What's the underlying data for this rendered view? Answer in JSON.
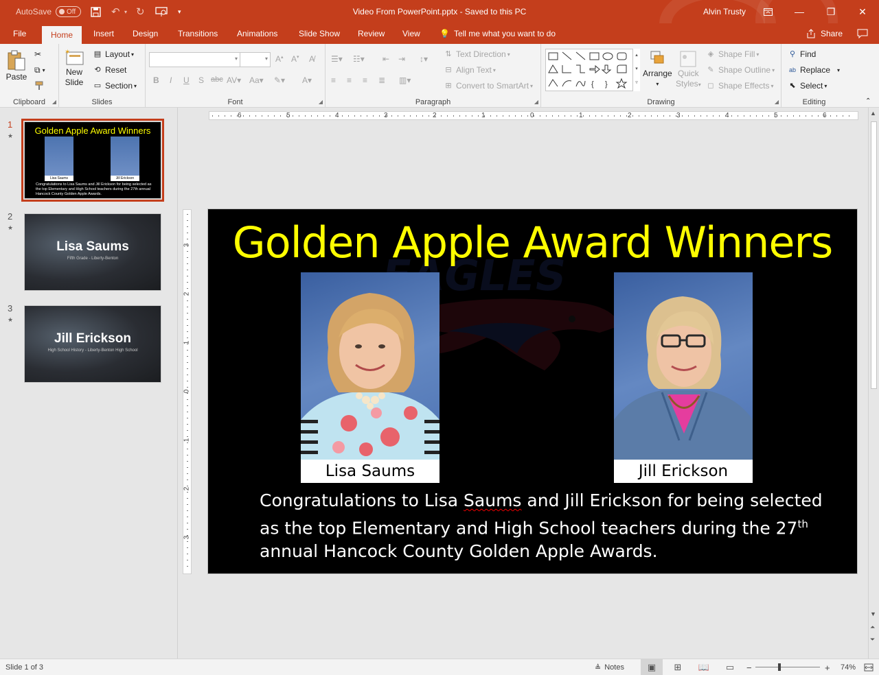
{
  "titlebar": {
    "autosave_label": "AutoSave",
    "autosave_state": "Off",
    "doc_title": "Video From PowerPoint.pptx  -  Saved to this PC",
    "user": "Alvin Trusty"
  },
  "tabs": [
    "File",
    "Home",
    "Insert",
    "Design",
    "Transitions",
    "Animations",
    "Slide Show",
    "Review",
    "View"
  ],
  "active_tab": "Home",
  "tell_me": "Tell me what you want to do",
  "share": "Share",
  "ribbon": {
    "clipboard": {
      "label": "Clipboard",
      "paste": "Paste"
    },
    "slides": {
      "label": "Slides",
      "new_slide_1": "New",
      "new_slide_2": "Slide",
      "layout": "Layout",
      "reset": "Reset",
      "section": "Section"
    },
    "font": {
      "label": "Font"
    },
    "paragraph": {
      "label": "Paragraph",
      "text_direction": "Text Direction",
      "align_text": "Align Text",
      "convert_smartart": "Convert to SmartArt"
    },
    "drawing": {
      "label": "Drawing",
      "arrange": "Arrange",
      "quick_styles_1": "Quick",
      "quick_styles_2": "Styles",
      "shape_fill": "Shape Fill",
      "shape_outline": "Shape Outline",
      "shape_effects": "Shape Effects"
    },
    "editing": {
      "label": "Editing",
      "find": "Find",
      "replace": "Replace",
      "select": "Select"
    }
  },
  "thumbnails": [
    {
      "number": "1",
      "title": "Golden Apple Award Winners",
      "cap1": "Lisa Saums",
      "cap2": "Jill Erickson",
      "text": "Congratulations to Lisa Saums and Jill Erickson for being selected as the top Elementary and High School teachers during the 27th annual Hancock County Golden Apple Awards."
    },
    {
      "number": "2",
      "name": "Lisa Saums",
      "sub": "Fifth Grade - Liberty-Benton"
    },
    {
      "number": "3",
      "name": "Jill Erickson",
      "sub": "High School History - Liberty-Benton High School"
    }
  ],
  "ruler": {
    "h_labels": [
      "6",
      "5",
      "4",
      "3",
      "2",
      "1",
      "0",
      "1",
      "2",
      "3",
      "4",
      "5",
      "6"
    ],
    "v_labels": [
      "3",
      "2",
      "1",
      "0",
      "1",
      "2",
      "3"
    ]
  },
  "slide": {
    "title": "Golden Apple Award Winners",
    "logo_text": "EAGLES",
    "caption_left": "Lisa Saums",
    "caption_right": "Jill Erickson",
    "body_pre": "Congratulations to Lisa ",
    "body_spell": "Saums",
    "body_mid": " and Jill Erickson for being selected as the top Elementary and High School teachers during the 27",
    "body_sup": "th",
    "body_post": " annual Hancock County Golden Apple Awards."
  },
  "status": {
    "slide_info": "Slide 1 of 3",
    "notes": "Notes",
    "zoom": "74%"
  },
  "colors": {
    "accent": "#c43e1c",
    "title_yellow": "#ffff00"
  }
}
